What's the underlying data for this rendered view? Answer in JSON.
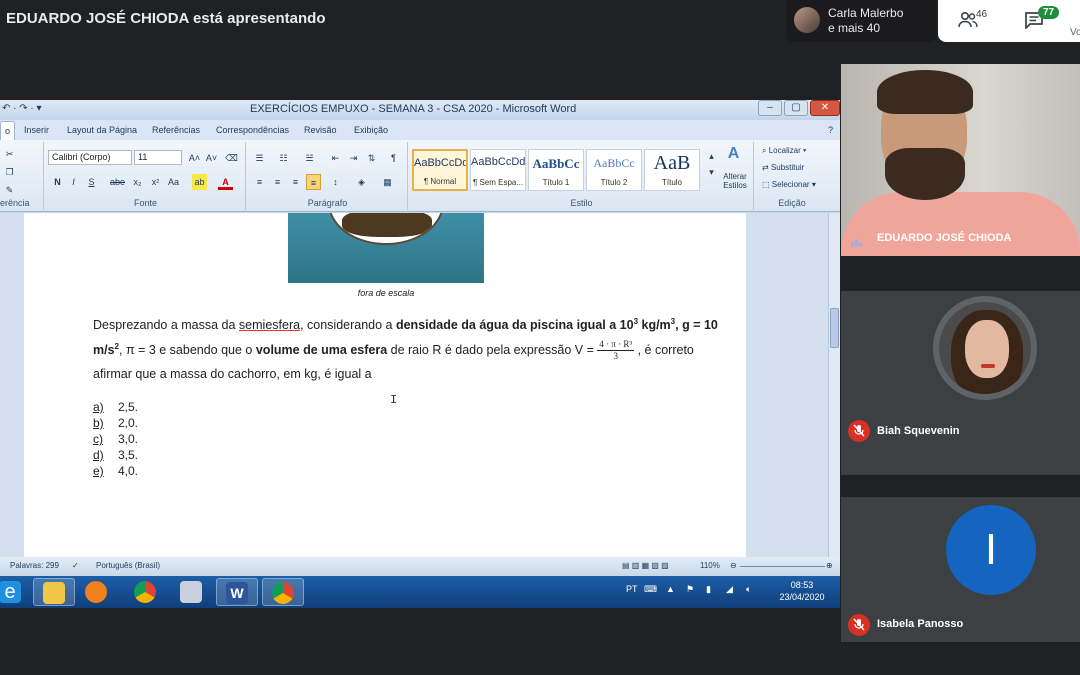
{
  "meet": {
    "presenting_text": "EDUARDO JOSÉ CHIODA está apresentando",
    "carla_name": "Carla Malerbo",
    "carla_more": "e mais 40",
    "people_count": "46",
    "chat_count": "77",
    "vo_text": "Vo"
  },
  "word": {
    "title": "EXERCÍCIOS EMPUXO - SEMANA 3 - CSA 2020 - Microsoft Word",
    "tabs": [
      "o",
      "Inserir",
      "Layout da Página",
      "Referências",
      "Correspondências",
      "Revisão",
      "Exibição"
    ],
    "font_name": "Calibri (Corpo)",
    "font_size": "11",
    "groups": {
      "clipboard": "erência",
      "font": "Fonte",
      "paragraph": "Parágrafo",
      "styles": "Estilo",
      "editing": "Edição"
    },
    "styles": [
      {
        "sample": "AaBbCcDd",
        "name": "¶ Normal"
      },
      {
        "sample": "AaBbCcDd",
        "name": "¶ Sem Espa..."
      },
      {
        "sample": "AaBbCc",
        "name": "Título 1"
      },
      {
        "sample": "AaBbCc",
        "name": "Título 2"
      },
      {
        "sample": "AaB",
        "name": "Título"
      }
    ],
    "change_styles": "Alterar Estilos",
    "edit_find": "Localizar",
    "edit_replace": "Substituir",
    "edit_select": "Selecionar",
    "caption": "fora de escala",
    "p1_a": "Desprezando a massa da ",
    "p1_b": "semiesfera",
    "p1_c": ", considerando a ",
    "p1_d": "densidade da água da piscina igual a 10",
    "p1_d_sup": "3",
    "p1_e": " kg/m",
    "p1_e_sup": "3",
    "p1_f": ", g = 10",
    "p2_a": "m/s",
    "p2_a_sup": "2",
    "p2_b": ",  π = 3  e sabendo que o ",
    "p2_c": "volume de uma esfera",
    "p2_d": " de raio R é dado pela expressão  V = ",
    "frac_num": "4 · π · R³",
    "frac_den": "3",
    "p2_e": " , é correto",
    "p3": "afirmar que a massa do cachorro, em kg, é igual a",
    "options": [
      {
        "letter": "a)",
        "value": "2,5."
      },
      {
        "letter": "b)",
        "value": "2,0."
      },
      {
        "letter": "c)",
        "value": "3,0."
      },
      {
        "letter": "d)",
        "value": "3,5."
      },
      {
        "letter": "e)",
        "value": "4,0."
      }
    ],
    "status_words": "Palavras: 299",
    "status_lang": "Português (Brasil)",
    "zoom": "110%"
  },
  "taskbar": {
    "lang": "PT",
    "time": "08:53",
    "date": "23/04/2020"
  },
  "participants": [
    {
      "name": "EDUARDO JOSÉ CHIODA"
    },
    {
      "name": "Biah Squevenin"
    },
    {
      "name": "Isabela Panosso",
      "initial": "I"
    }
  ],
  "colors": {
    "meet_bg": "#202124",
    "tile_bg": "#3c4043",
    "avatar_blue": "#1565c0",
    "mic_off_red": "#d93025",
    "chat_badge_green": "#1e8e3e"
  }
}
